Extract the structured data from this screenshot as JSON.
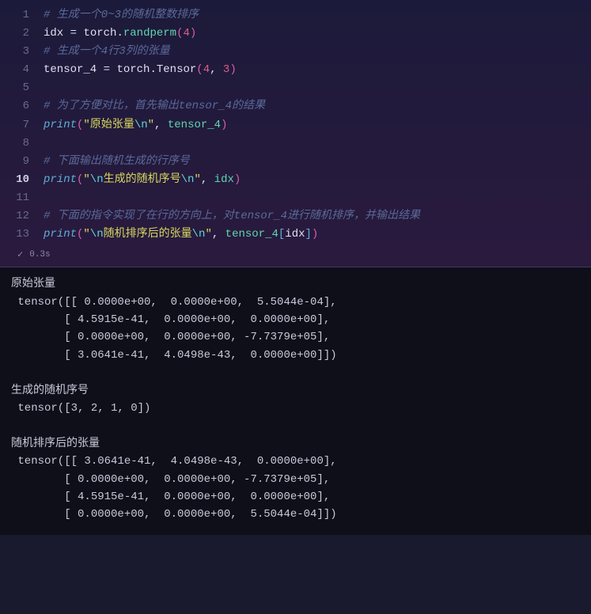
{
  "code": {
    "lines": [
      {
        "num": "1",
        "segments": [
          {
            "cls": "comment",
            "t": "# 生成一个0~3的随机整数排序"
          }
        ]
      },
      {
        "num": "2",
        "segments": [
          {
            "cls": "ident",
            "t": "idx"
          },
          {
            "cls": "op",
            "t": " "
          },
          {
            "cls": "op",
            "t": "="
          },
          {
            "cls": "op",
            "t": " "
          },
          {
            "cls": "ident",
            "t": "torch"
          },
          {
            "cls": "op",
            "t": "."
          },
          {
            "cls": "method-hl",
            "t": "randperm"
          },
          {
            "cls": "paren",
            "t": "("
          },
          {
            "cls": "number",
            "t": "4"
          },
          {
            "cls": "paren",
            "t": ")"
          }
        ]
      },
      {
        "num": "3",
        "segments": [
          {
            "cls": "comment",
            "t": "# 生成一个4行3列的张量"
          }
        ]
      },
      {
        "num": "4",
        "segments": [
          {
            "cls": "ident",
            "t": "tensor_4"
          },
          {
            "cls": "op",
            "t": " "
          },
          {
            "cls": "op",
            "t": "="
          },
          {
            "cls": "op",
            "t": " "
          },
          {
            "cls": "ident",
            "t": "torch"
          },
          {
            "cls": "op",
            "t": "."
          },
          {
            "cls": "method",
            "t": "Tensor"
          },
          {
            "cls": "paren",
            "t": "("
          },
          {
            "cls": "number",
            "t": "4"
          },
          {
            "cls": "op",
            "t": ", "
          },
          {
            "cls": "number",
            "t": "3"
          },
          {
            "cls": "paren",
            "t": ")"
          }
        ]
      },
      {
        "num": "5",
        "segments": []
      },
      {
        "num": "6",
        "segments": [
          {
            "cls": "comment",
            "t": "# 为了方便对比，首先输出tensor_4的结果"
          }
        ]
      },
      {
        "num": "7",
        "segments": [
          {
            "cls": "builtin",
            "t": "print"
          },
          {
            "cls": "paren",
            "t": "("
          },
          {
            "cls": "string-q",
            "t": "\"原始张量"
          },
          {
            "cls": "string-esc",
            "t": "\\n"
          },
          {
            "cls": "string-q",
            "t": "\""
          },
          {
            "cls": "op",
            "t": ", "
          },
          {
            "cls": "func",
            "t": "tensor_4"
          },
          {
            "cls": "paren",
            "t": ")"
          }
        ]
      },
      {
        "num": "8",
        "segments": []
      },
      {
        "num": "9",
        "segments": [
          {
            "cls": "comment",
            "t": "# 下面输出随机生成的行序号"
          }
        ]
      },
      {
        "num": "10",
        "current": true,
        "segments": [
          {
            "cls": "builtin",
            "t": "print"
          },
          {
            "cls": "paren",
            "t": "("
          },
          {
            "cls": "string-q",
            "t": "\""
          },
          {
            "cls": "string-esc",
            "t": "\\n"
          },
          {
            "cls": "string-q",
            "t": "生成的随机序号"
          },
          {
            "cls": "string-esc",
            "t": "\\n"
          },
          {
            "cls": "string-q",
            "t": "\""
          },
          {
            "cls": "op",
            "t": ", "
          },
          {
            "cls": "func",
            "t": "idx"
          },
          {
            "cls": "paren",
            "t": ")"
          }
        ]
      },
      {
        "num": "11",
        "segments": []
      },
      {
        "num": "12",
        "segments": [
          {
            "cls": "comment",
            "t": "# 下面的指令实现了在行的方向上，对tensor_4进行随机排序，并输出结果"
          }
        ]
      },
      {
        "num": "13",
        "segments": [
          {
            "cls": "builtin",
            "t": "print"
          },
          {
            "cls": "paren",
            "t": "("
          },
          {
            "cls": "string-q",
            "t": "\""
          },
          {
            "cls": "string-esc",
            "t": "\\n"
          },
          {
            "cls": "string-q",
            "t": "随机排序后的张量"
          },
          {
            "cls": "string-esc",
            "t": "\\n"
          },
          {
            "cls": "string-q",
            "t": "\""
          },
          {
            "cls": "op",
            "t": ", "
          },
          {
            "cls": "func",
            "t": "tensor_4"
          },
          {
            "cls": "paren2",
            "t": "["
          },
          {
            "cls": "ident",
            "t": "idx"
          },
          {
            "cls": "paren2",
            "t": "]"
          },
          {
            "cls": "paren",
            "t": ")"
          }
        ]
      }
    ]
  },
  "status": {
    "time": "0.3s"
  },
  "output": "原始张量\n tensor([[ 0.0000e+00,  0.0000e+00,  5.5044e-04],\n        [ 4.5915e-41,  0.0000e+00,  0.0000e+00],\n        [ 0.0000e+00,  0.0000e+00, -7.7379e+05],\n        [ 3.0641e-41,  4.0498e-43,  0.0000e+00]])\n\n生成的随机序号\n tensor([3, 2, 1, 0])\n\n随机排序后的张量\n tensor([[ 3.0641e-41,  4.0498e-43,  0.0000e+00],\n        [ 0.0000e+00,  0.0000e+00, -7.7379e+05],\n        [ 4.5915e-41,  0.0000e+00,  0.0000e+00],\n        [ 0.0000e+00,  0.0000e+00,  5.5044e-04]])"
}
